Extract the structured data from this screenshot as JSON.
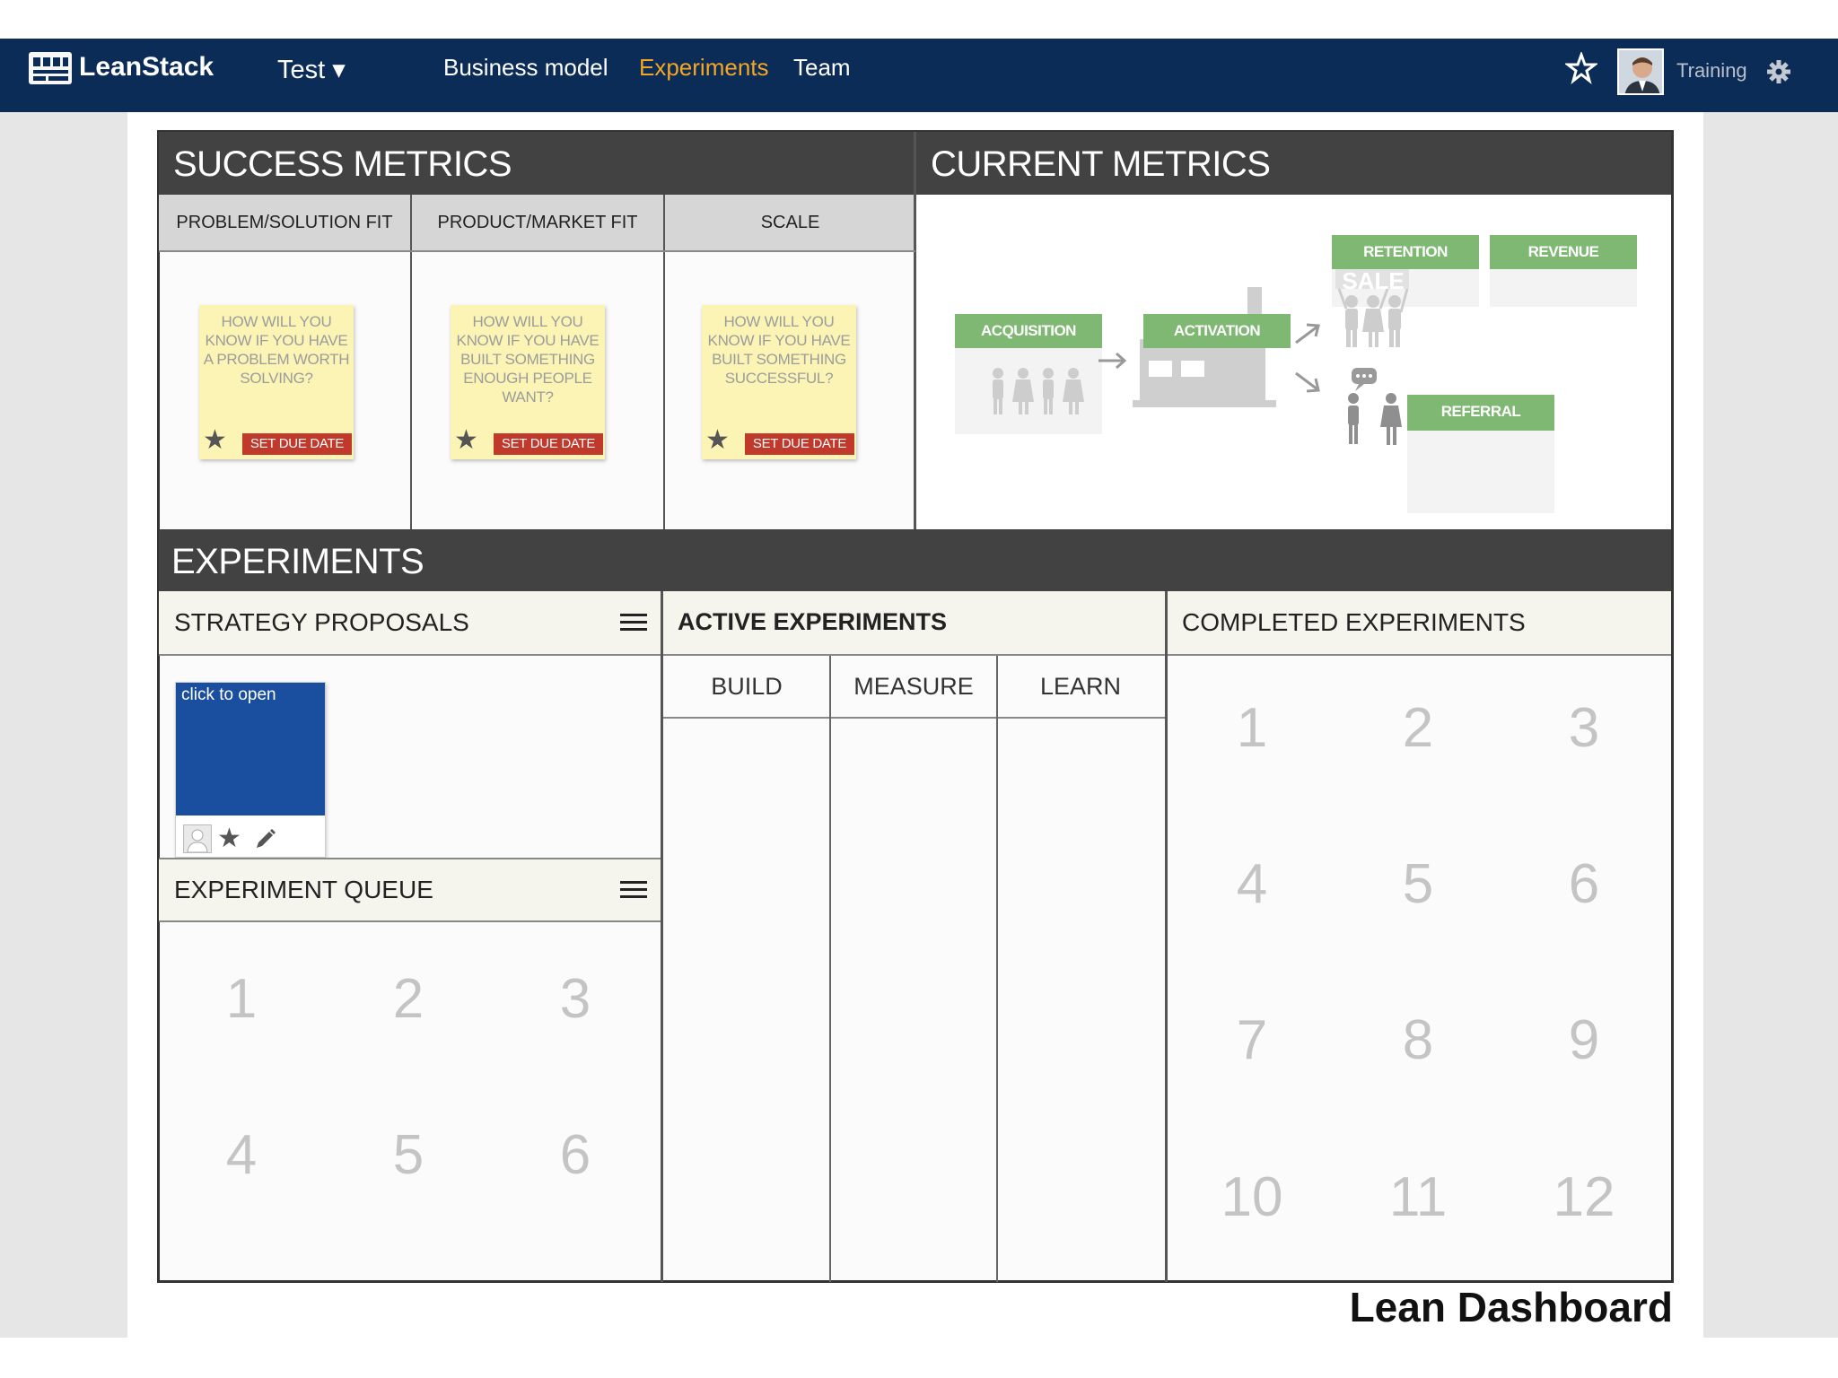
{
  "nav": {
    "brand": "LeanStack",
    "project": "Test ▾",
    "links": [
      "Business model",
      "Experiments",
      "Team"
    ],
    "user": "Training"
  },
  "success": {
    "title": "SUCCESS METRICS",
    "columns": [
      "PROBLEM/SOLUTION FIT",
      "PRODUCT/MARKET FIT",
      "SCALE"
    ],
    "cards": [
      "HOW WILL YOU KNOW IF YOU HAVE A PROBLEM WORTH SOLVING?",
      "HOW WILL YOU KNOW IF YOU HAVE BUILT SOMETHING ENOUGH PEOPLE WANT?",
      "HOW WILL YOU KNOW IF YOU HAVE BUILT SOMETHING SUCCESSFUL?"
    ],
    "due_label": "SET DUE DATE"
  },
  "current": {
    "title": "CURRENT METRICS",
    "acquisition": "ACQUISITION",
    "activation": "ACTIVATION",
    "retention": "RETENTION",
    "revenue": "REVENUE",
    "referral": "REFERRAL",
    "sale": "SALE"
  },
  "experiments": {
    "title": "EXPERIMENTS",
    "strategy": "STRATEGY PROPOSALS",
    "card_label": "click to open",
    "queue": "EXPERIMENT QUEUE",
    "queue_numbers": [
      "1",
      "2",
      "3",
      "4",
      "5",
      "6"
    ],
    "active": "ACTIVE EXPERIMENTS",
    "active_cols": [
      "BUILD",
      "MEASURE",
      "LEARN"
    ],
    "completed": "COMPLETED EXPERIMENTS",
    "completed_numbers": [
      "1",
      "2",
      "3",
      "4",
      "5",
      "6",
      "7",
      "8",
      "9",
      "10",
      "11",
      "12"
    ]
  },
  "footer": {
    "title": "Lean Dashboard"
  },
  "colors": {
    "nav_bg": "#0b2c57",
    "nav_active": "#f5a623",
    "header_dark": "#424242",
    "metric_green": "#7eb872",
    "sticky_yellow": "#fbf4b4",
    "due_red": "#c0392b",
    "card_blue": "#1a4fa0"
  }
}
